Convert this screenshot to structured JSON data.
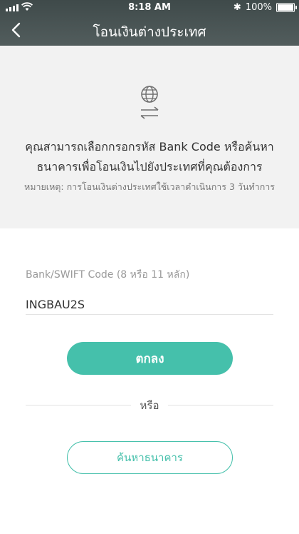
{
  "status_bar": {
    "time": "8:18 AM",
    "battery_text": "100%",
    "battery_level": 1.0,
    "icons": [
      "signal-icon",
      "wifi-icon",
      "bluetooth-icon",
      "battery-icon"
    ]
  },
  "nav": {
    "title": "โอนเงินต่างประเทศ",
    "back_icon": "chevron-left-icon"
  },
  "info": {
    "icon": "globe-exchange-icon",
    "description_line1": "คุณสามารถเลือกกรอกรหัส Bank Code หรือค้นหา",
    "description_line2": "ธนาคารเพื่อโอนเงินไปยังประเทศที่คุณต้องการ",
    "note": "หมายเหตุ: การโอนเงินต่างประเทศใช้เวลาดำเนินการ 3 วันทำการ"
  },
  "form": {
    "label": "Bank/SWIFT Code (8 หรือ 11 หลัก)",
    "value": "INGBAU2S"
  },
  "actions": {
    "ok_label": "ตกลง",
    "or_label": "หรือ",
    "search_label": "ค้นหาธนาคาร"
  },
  "colors": {
    "header": "#4a5555",
    "accent": "#45c0ab",
    "grey_bg": "#f2f2f2"
  }
}
